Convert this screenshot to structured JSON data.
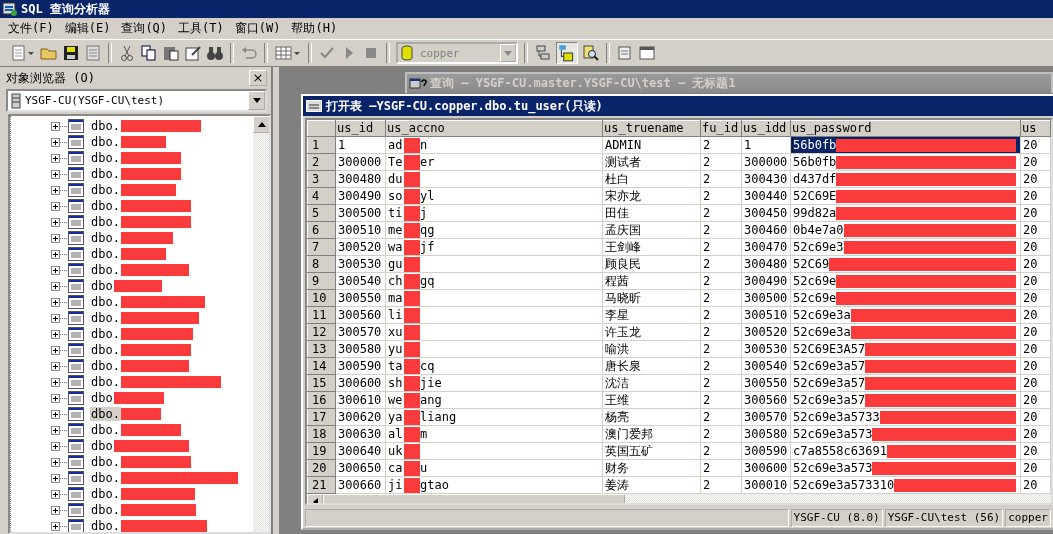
{
  "window": {
    "title": "SQL 查询分析器"
  },
  "menu": [
    "文件(F)",
    "编辑(E)",
    "查询(Q)",
    "工具(T)",
    "窗口(W)",
    "帮助(H)"
  ],
  "toolbar": {
    "database": "copper"
  },
  "object_browser": {
    "title": "对象浏览器 (O)",
    "close": "×",
    "server": "YSGF-CU(YSGF-CU\\test)",
    "items": [
      {
        "label": "dbo.",
        "selected": false
      },
      {
        "label": "dbo.",
        "selected": false
      },
      {
        "label": "dbo.",
        "selected": false
      },
      {
        "label": "dbo.",
        "selected": false
      },
      {
        "label": "dbo.",
        "selected": false
      },
      {
        "label": "dbo.",
        "selected": false
      },
      {
        "label": "dbo.",
        "selected": false
      },
      {
        "label": "dbo.",
        "selected": false
      },
      {
        "label": "dbo.",
        "selected": false
      },
      {
        "label": "dbo.",
        "selected": false
      },
      {
        "label": "dbo",
        "selected": false
      },
      {
        "label": "dbo.",
        "selected": false
      },
      {
        "label": "dbo.",
        "selected": false
      },
      {
        "label": "dbo.",
        "selected": false
      },
      {
        "label": "dbo.",
        "selected": false
      },
      {
        "label": "dbo.",
        "selected": false
      },
      {
        "label": "dbo.",
        "selected": false
      },
      {
        "label": "dbo",
        "selected": false
      },
      {
        "label": "dbo.",
        "selected": true
      },
      {
        "label": "dbo.",
        "selected": false
      },
      {
        "label": "dbo",
        "selected": false
      },
      {
        "label": "dbo.",
        "selected": false
      },
      {
        "label": "dbo.",
        "selected": false
      },
      {
        "label": "dbo.",
        "selected": false
      },
      {
        "label": "dbo.",
        "selected": false
      },
      {
        "label": "dbo.",
        "selected": false
      }
    ]
  },
  "query_window": {
    "title": "查询 — YSGF-CU.master.YSGF-CU\\test — 无标题1"
  },
  "table_window": {
    "title": "打开表 —YSGF-CU.copper.dbo.tu_user(只读)",
    "columns": [
      "us_id",
      "us_accno",
      "us_truename",
      "fu_id",
      "us_idd",
      "us_password",
      "us"
    ],
    "rows": [
      {
        "n": "1",
        "us_id": "1",
        "accno_start": "ad",
        "accno_end": "n",
        "truename": "ADMIN",
        "fu_id": "2",
        "us_idd": "1",
        "password": "56b0fb",
        "next": "20",
        "selected": true
      },
      {
        "n": "2",
        "us_id": "300000",
        "accno_start": "Te",
        "accno_end": "er",
        "truename": "测试者",
        "fu_id": "2",
        "us_idd": "300000",
        "password": "56b0fb",
        "next": "20",
        "selected": false
      },
      {
        "n": "3",
        "us_id": "300480",
        "accno_start": "du",
        "truename": "杜白",
        "fu_id": "2",
        "us_idd": "300430",
        "password": "d437df",
        "next": "20",
        "selected": false
      },
      {
        "n": "4",
        "us_id": "300490",
        "accno_start": "so",
        "accno_end": "yl",
        "truename": "宋亦龙",
        "fu_id": "2",
        "us_idd": "300440",
        "password": "52C69E",
        "next": "20",
        "selected": false
      },
      {
        "n": "5",
        "us_id": "300500",
        "accno_start": "ti",
        "accno_end": "j",
        "truename": "田佳",
        "fu_id": "2",
        "us_idd": "300450",
        "password": "99d82a",
        "next": "20",
        "selected": false
      },
      {
        "n": "6",
        "us_id": "300510",
        "accno_start": "me",
        "accno_end": "qg",
        "truename": "孟庆国",
        "fu_id": "2",
        "us_idd": "300460",
        "password": "0b4e7a0",
        "next": "20",
        "selected": false
      },
      {
        "n": "7",
        "us_id": "300520",
        "accno_start": "wa",
        "accno_end": "jf",
        "truename": "王剑峰",
        "fu_id": "2",
        "us_idd": "300470",
        "password": "52c69e3",
        "next": "20",
        "selected": false
      },
      {
        "n": "8",
        "us_id": "300530",
        "accno_start": "gu",
        "truename": "顾良民",
        "fu_id": "2",
        "us_idd": "300480",
        "password": "52C69",
        "next": "20",
        "selected": false
      },
      {
        "n": "9",
        "us_id": "300540",
        "accno_start": "ch",
        "accno_end": "gq",
        "truename": "程茜",
        "fu_id": "2",
        "us_idd": "300490",
        "password": "52c69e",
        "next": "20",
        "selected": false
      },
      {
        "n": "10",
        "us_id": "300550",
        "accno_start": "ma",
        "truename": "马晓昕",
        "fu_id": "2",
        "us_idd": "300500",
        "password": "52c69e",
        "next": "20",
        "selected": false
      },
      {
        "n": "11",
        "us_id": "300560",
        "accno_start": "li",
        "truename": "李星",
        "fu_id": "2",
        "us_idd": "300510",
        "password": "52c69e3a",
        "next": "20",
        "selected": false
      },
      {
        "n": "12",
        "us_id": "300570",
        "accno_start": "xu",
        "truename": "许玉龙",
        "fu_id": "2",
        "us_idd": "300520",
        "password": "52c69e3a",
        "next": "20",
        "selected": false
      },
      {
        "n": "13",
        "us_id": "300580",
        "accno_start": "yu",
        "truename": "喻洪",
        "fu_id": "2",
        "us_idd": "300530",
        "password": "52C69E3A57",
        "next": "20",
        "selected": false
      },
      {
        "n": "14",
        "us_id": "300590",
        "accno_start": "ta",
        "accno_end": "cq",
        "truename": "唐长泉",
        "fu_id": "2",
        "us_idd": "300540",
        "password": "52c69e3a57",
        "next": "20",
        "selected": false
      },
      {
        "n": "15",
        "us_id": "300600",
        "accno_start": "sh",
        "accno_end": "jie",
        "truename": "沈洁",
        "fu_id": "2",
        "us_idd": "300550",
        "password": "52c69e3a57",
        "next": "20",
        "selected": false
      },
      {
        "n": "16",
        "us_id": "300610",
        "accno_start": "we",
        "accno_end": "ang",
        "truename": "王维",
        "fu_id": "2",
        "us_idd": "300560",
        "password": "52c69e3a57",
        "next": "20",
        "selected": false
      },
      {
        "n": "17",
        "us_id": "300620",
        "accno_start": "ya",
        "accno_end": "liang",
        "truename": "杨亮",
        "fu_id": "2",
        "us_idd": "300570",
        "password": "52c69e3a5733",
        "next": "20",
        "selected": false
      },
      {
        "n": "18",
        "us_id": "300630",
        "accno_start": "al",
        "accno_end": "m",
        "truename": "澳门爱邦",
        "fu_id": "2",
        "us_idd": "300580",
        "password": "52c69e3a573",
        "next": "20",
        "selected": false
      },
      {
        "n": "19",
        "us_id": "300640",
        "accno_start": "uk",
        "truename": "英国五矿",
        "fu_id": "2",
        "us_idd": "300590",
        "password": "c7a8558c63691",
        "next": "20",
        "selected": false
      },
      {
        "n": "20",
        "us_id": "300650",
        "accno_start": "ca",
        "accno_end": "u",
        "truename": "财务",
        "fu_id": "2",
        "us_idd": "300600",
        "password": "52c69e3a573",
        "next": "20",
        "selected": false
      },
      {
        "n": "21",
        "us_id": "300660",
        "accno_start": "ji",
        "accno_end": "gtao",
        "truename": "姜涛",
        "fu_id": "2",
        "us_idd": "300010",
        "password": "52c69e3a573310",
        "next": "20",
        "selected": false
      }
    ]
  },
  "status_bar": [
    "YSGF-CU (8.0)",
    "YSGF-CU\\test (56)",
    "copper"
  ]
}
